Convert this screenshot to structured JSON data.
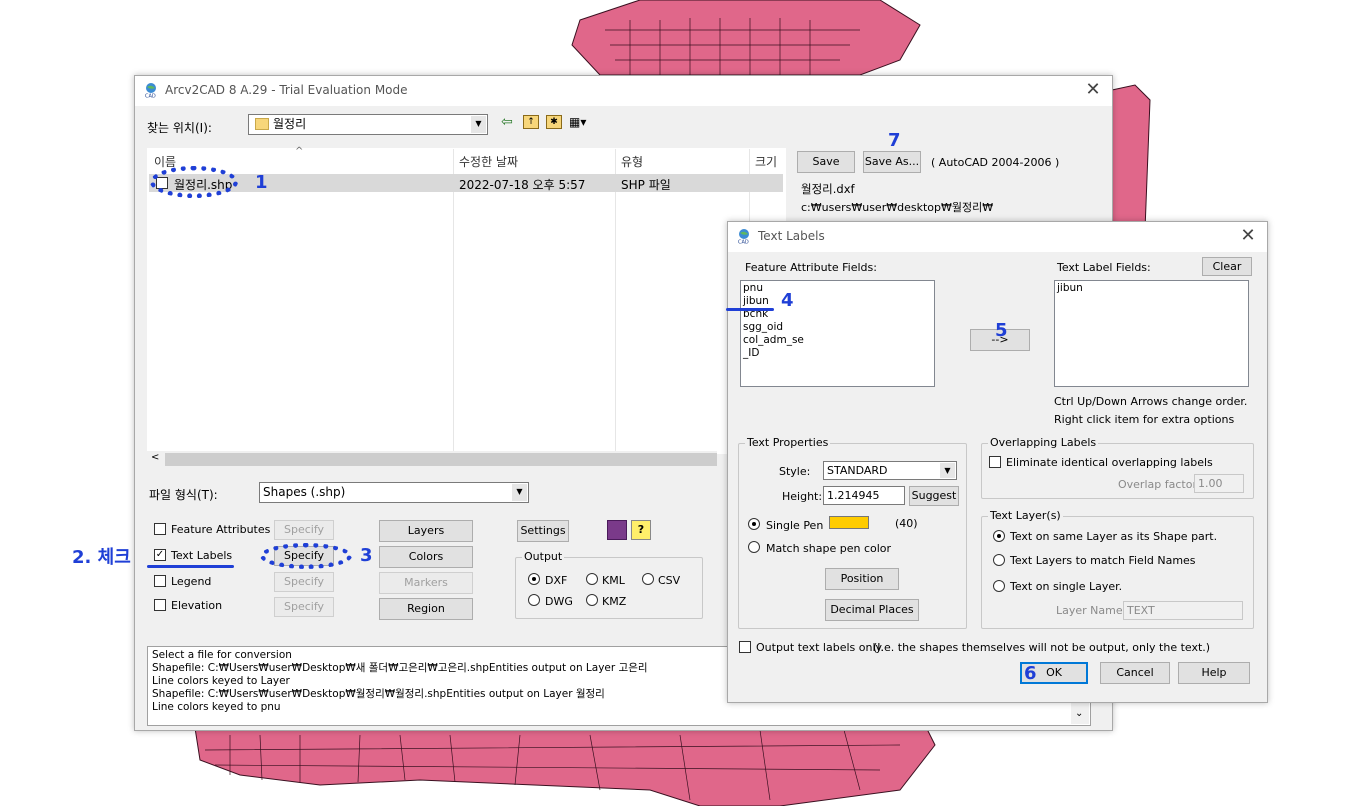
{
  "main": {
    "title": "Arcv2CAD 8 A.29 - Trial Evaluation Mode",
    "look_in_label": "찾는 위치(I):",
    "look_in_value": "월정리",
    "columns": [
      "이름",
      "수정한 날짜",
      "유형",
      "크기"
    ],
    "file": {
      "name": "월정리.shp",
      "modified": "2022-07-18 오후 5:57",
      "type": "SHP 파일"
    },
    "save_label": "Save",
    "save_as_label": "Save As...",
    "format_note": "( AutoCAD 2004-2006 )",
    "output_file": "월정리.dxf",
    "output_path": "c:₩users₩user₩desktop₩월정리₩",
    "file_type_label": "파일 형식(T):",
    "file_type_value": "Shapes (.shp)",
    "options": [
      {
        "label": "Feature Attributes",
        "checked": false,
        "specify": "Specify",
        "specify_enabled": false
      },
      {
        "label": "Text Labels",
        "checked": true,
        "specify": "Specify",
        "specify_enabled": true
      },
      {
        "label": "Legend",
        "checked": false,
        "specify": "Specify",
        "specify_enabled": false
      },
      {
        "label": "Elevation",
        "checked": false,
        "specify": "Specify",
        "specify_enabled": false
      }
    ],
    "right_buttons": [
      "Layers",
      "Colors",
      "Markers",
      "Region"
    ],
    "settings_label": "Settings",
    "help_icon_text": "?",
    "output_group": {
      "title": "Output",
      "options": [
        {
          "label": "DXF",
          "selected": true
        },
        {
          "label": "KML",
          "selected": false
        },
        {
          "label": "CSV",
          "selected": false
        },
        {
          "label": "DWG",
          "selected": false
        },
        {
          "label": "KMZ",
          "selected": false
        }
      ]
    },
    "log_lines": [
      "Select a file for conversion",
      "Shapefile: C:₩Users₩user₩Desktop₩새 폴더₩고은리₩고은리.shpEntities output on Layer 고은리",
      "Line colors keyed to Layer",
      "Shapefile: C:₩Users₩user₩Desktop₩월정리₩월정리.shpEntities output on Layer 월정리",
      "Line colors keyed to pnu"
    ]
  },
  "text_labels_dialog": {
    "title": "Text Labels",
    "feature_fields_label": "Feature Attribute Fields:",
    "feature_fields": [
      "pnu",
      "jibun",
      "bchk",
      "sgg_oid",
      "col_adm_se",
      "_ID"
    ],
    "arrow_button": "-->",
    "label_fields_label": "Text Label Fields:",
    "clear_label": "Clear",
    "label_fields": [
      "jibun"
    ],
    "hint_line1": "Ctrl Up/Down Arrows change order.",
    "hint_line2": "Right click item for extra options",
    "text_properties": {
      "title": "Text Properties",
      "style_label": "Style:",
      "style_value": "STANDARD",
      "height_label": "Height:",
      "height_value": "1.214945",
      "suggest_label": "Suggest",
      "single_pen_label": "Single Pen",
      "pen_color": "#ffcc00",
      "pen_number": "(40)",
      "match_pen_label": "Match shape pen color",
      "position_label": "Position",
      "decimal_label": "Decimal Places"
    },
    "overlapping": {
      "title": "Overlapping Labels",
      "eliminate_label": "Eliminate identical overlapping labels",
      "factor_label": "Overlap factor:",
      "factor_value": "1.00"
    },
    "text_layers": {
      "title": "Text Layer(s)",
      "options": [
        {
          "label": "Text on same Layer as its Shape part.",
          "selected": true
        },
        {
          "label": "Text Layers to match Field Names",
          "selected": false
        },
        {
          "label": "Text on single Layer.",
          "selected": false
        }
      ],
      "layer_name_label": "Layer Name:",
      "layer_name_value": "TEXT"
    },
    "output_only_label": "Output text labels only.",
    "output_only_note": "(I.e. the shapes themselves will not be output, only the text.)",
    "ok_label": "OK",
    "cancel_label": "Cancel",
    "help_label": "Help"
  },
  "annotations": {
    "n1": "1",
    "n2": "2. 체크",
    "n3": "3",
    "n4": "4",
    "n5": "5",
    "n6": "6",
    "n7": "7"
  },
  "colors": {
    "annotation": "#1f3fd6",
    "map_fill": "#e0678a",
    "selection": "#d9d9d9"
  }
}
